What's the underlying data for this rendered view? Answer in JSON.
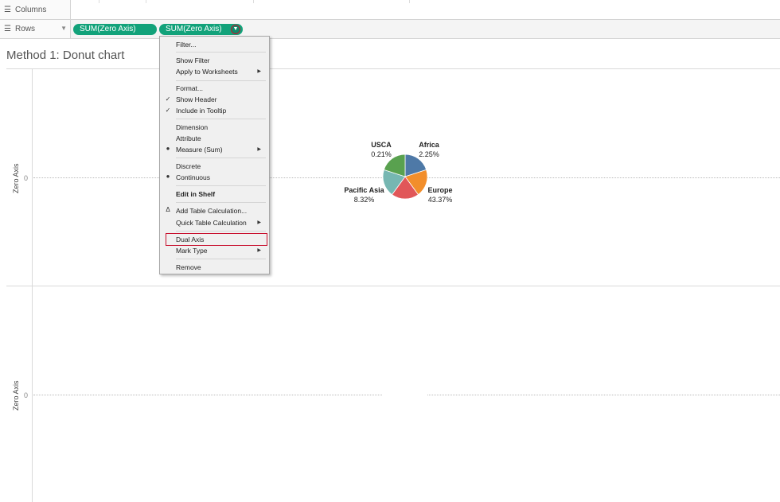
{
  "shelves": {
    "columns_label": "Columns",
    "rows_label": "Rows",
    "row_pills": [
      "SUM(Zero Axis)",
      "SUM(Zero Axis)"
    ]
  },
  "sheet": {
    "title": "Method 1: Donut chart",
    "axis_title": "Zero Axis",
    "axis_zero_label": "0"
  },
  "chart_data": {
    "type": "pie",
    "slices": [
      {
        "name": "Africa",
        "label": "2.25%",
        "color": "#4e79a7"
      },
      {
        "name": "Europe",
        "label": "43.37%",
        "color": "#f28e2b"
      },
      {
        "name": "",
        "label": "",
        "color": "#e15759"
      },
      {
        "name": "Pacific Asia",
        "label": "8.32%",
        "color": "#76b7b2"
      },
      {
        "name": "USCA",
        "label": "0.21%",
        "color": "#59a14f"
      }
    ],
    "values": [
      0.2,
      0.2,
      0.2,
      0.2,
      0.2
    ]
  },
  "menu": {
    "items": [
      {
        "label": "Filter...",
        "mark": "",
        "arrow": false,
        "bold": false
      },
      {
        "label": "Show Filter",
        "mark": "",
        "arrow": false,
        "bold": false
      },
      {
        "label": "Apply to Worksheets",
        "mark": "",
        "arrow": true,
        "bold": false
      },
      {
        "label": "Format...",
        "mark": "",
        "arrow": false,
        "bold": false
      },
      {
        "label": "Show Header",
        "mark": "check",
        "arrow": false,
        "bold": false
      },
      {
        "label": "Include in Tooltip",
        "mark": "check",
        "arrow": false,
        "bold": false
      },
      {
        "label": "Dimension",
        "mark": "",
        "arrow": false,
        "bold": false
      },
      {
        "label": "Attribute",
        "mark": "",
        "arrow": false,
        "bold": false
      },
      {
        "label": "Measure (Sum)",
        "mark": "dot",
        "arrow": true,
        "bold": false
      },
      {
        "label": "Discrete",
        "mark": "",
        "arrow": false,
        "bold": false
      },
      {
        "label": "Continuous",
        "mark": "dot",
        "arrow": false,
        "bold": false
      },
      {
        "label": "Edit in Shelf",
        "mark": "",
        "arrow": false,
        "bold": true
      },
      {
        "label": "Add Table Calculation...",
        "mark": "delta",
        "arrow": false,
        "bold": false
      },
      {
        "label": "Quick Table Calculation",
        "mark": "",
        "arrow": true,
        "bold": false
      },
      {
        "label": "Dual Axis",
        "mark": "",
        "arrow": false,
        "bold": false
      },
      {
        "label": "Mark Type",
        "mark": "",
        "arrow": true,
        "bold": false
      },
      {
        "label": "Remove",
        "mark": "",
        "arrow": false,
        "bold": false
      }
    ]
  }
}
